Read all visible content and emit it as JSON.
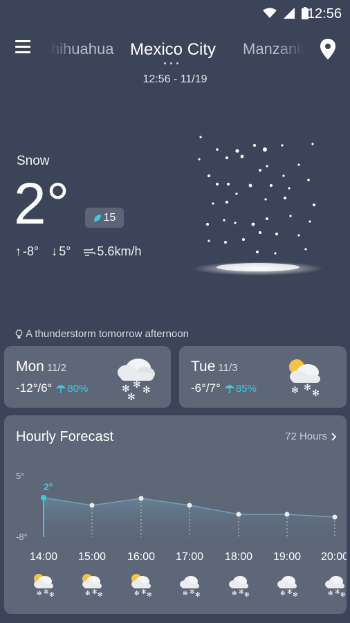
{
  "status": {
    "time": "12:56"
  },
  "cities": {
    "previous": "Chihuahua",
    "current": "Mexico City",
    "next": "Manzanillo"
  },
  "datetime": "12:56 - 11/19",
  "current": {
    "condition": "Snow",
    "temperature": "2°",
    "aqi": "15",
    "high": "-8°",
    "low": "5°",
    "wind": "5.6km/h"
  },
  "tip": "A thunderstorm tomorrow afternoon",
  "days": [
    {
      "day": "Mon",
      "date": "11/2",
      "range": "-12°/6°",
      "rain": "80%",
      "icon": "cloud-snow-icon"
    },
    {
      "day": "Tue",
      "date": "11/3",
      "range": "-6°/7°",
      "rain": "85%",
      "icon": "partly-sunny-snow-icon"
    }
  ],
  "hourly": {
    "title": "Hourly Forecast",
    "link": "72 Hours",
    "axis_top": "5°",
    "axis_bottom": "-8°",
    "current_label": "2°",
    "hours": [
      "14:00",
      "15:00",
      "16:00",
      "17:00",
      "18:00",
      "19:00",
      "20:00"
    ],
    "icons": [
      "sun-cloud-snow-icon",
      "sun-cloud-snow-icon",
      "sun-cloud-snow-icon",
      "cloud-snow-icon",
      "cloud-snow-icon",
      "cloud-snow-icon",
      "cloud-snow-icon"
    ],
    "accent": "#3ec8e0"
  }
}
